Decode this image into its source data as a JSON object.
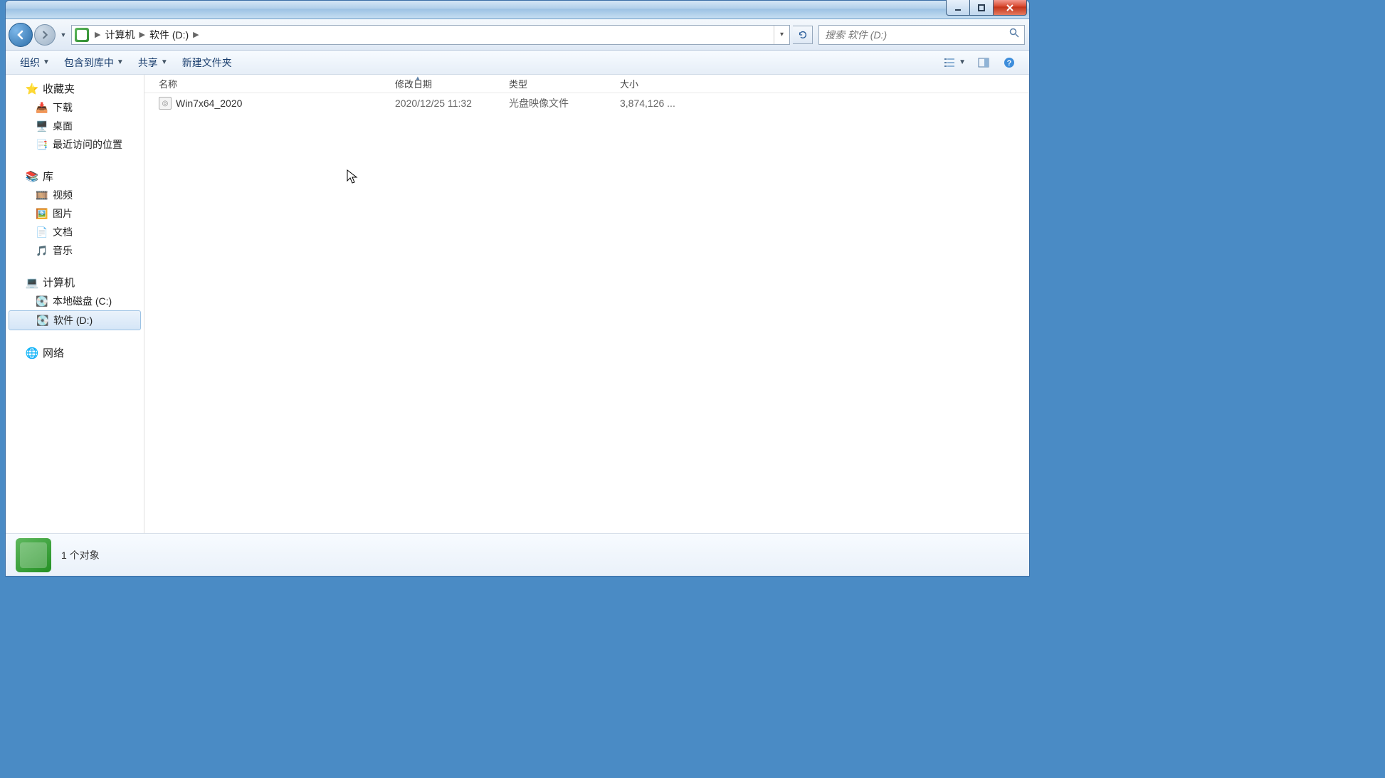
{
  "titlebar": {},
  "nav": {
    "breadcrumb": [
      "计算机",
      "软件 (D:)"
    ],
    "refresh_alt": "刷新"
  },
  "search": {
    "placeholder": "搜索 软件 (D:)"
  },
  "toolbar": {
    "organize": "组织",
    "include": "包含到库中",
    "share": "共享",
    "newfolder": "新建文件夹"
  },
  "columns": {
    "name": "名称",
    "date": "修改日期",
    "type": "类型",
    "size": "大小"
  },
  "sidebar": {
    "favorites": {
      "label": "收藏夹",
      "items": [
        "下载",
        "桌面",
        "最近访问的位置"
      ]
    },
    "libraries": {
      "label": "库",
      "items": [
        "视频",
        "图片",
        "文档",
        "音乐"
      ]
    },
    "computer": {
      "label": "计算机",
      "items": [
        "本地磁盘 (C:)",
        "软件 (D:)"
      ]
    },
    "network": {
      "label": "网络"
    }
  },
  "files": [
    {
      "name": "Win7x64_2020",
      "date": "2020/12/25 11:32",
      "type": "光盘映像文件",
      "size": "3,874,126 ..."
    }
  ],
  "details": {
    "status": "1 个对象"
  }
}
